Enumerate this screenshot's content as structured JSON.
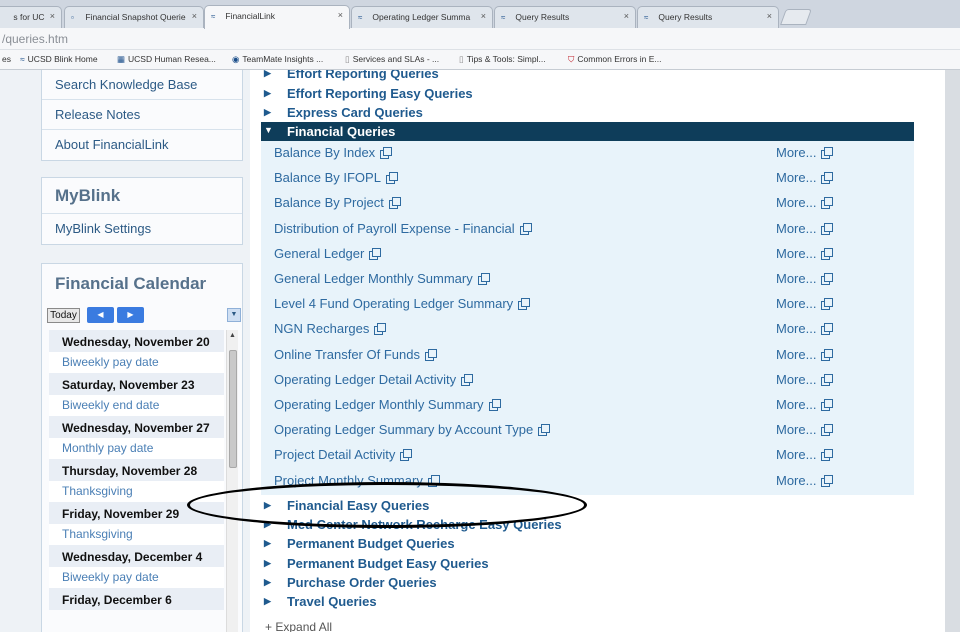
{
  "tabs": [
    {
      "label": "s for UC",
      "active": false
    },
    {
      "label": "Financial Snapshot Querie",
      "active": false
    },
    {
      "label": "FinancialLink",
      "active": true
    },
    {
      "label": "Operating Ledger Summa",
      "active": false
    },
    {
      "label": "Query Results",
      "active": false
    },
    {
      "label": "Query Results",
      "active": false
    }
  ],
  "tab_close_glyph": "×",
  "url": "/queries.htm",
  "bookmarks": [
    {
      "label": "es",
      "icon": ""
    },
    {
      "label": "UCSD Blink Home",
      "icon": "blink-icon"
    },
    {
      "label": "UCSD Human Resea...",
      "icon": "ucsd-icon"
    },
    {
      "label": "TeamMate Insights ...",
      "icon": "teammate-icon"
    },
    {
      "label": "Services and SLAs - ...",
      "icon": "doc-icon"
    },
    {
      "label": "Tips & Tools: Simpl...",
      "icon": "doc-icon"
    },
    {
      "label": "Common Errors in E...",
      "icon": "shield-icon"
    }
  ],
  "sidebar": {
    "help_links": [
      "Search Knowledge Base",
      "Release Notes",
      "About FinancialLink"
    ],
    "myblink": {
      "title": "MyBlink",
      "links": [
        "MyBlink Settings"
      ]
    },
    "calendar": {
      "title": "Financial Calendar",
      "today_label": "Today",
      "events": [
        {
          "date": "Wednesday, November 20",
          "items": [
            "Biweekly pay date"
          ]
        },
        {
          "date": "Saturday, November 23",
          "items": [
            "Biweekly end date"
          ]
        },
        {
          "date": "Wednesday, November 27",
          "items": [
            "Monthly pay date"
          ]
        },
        {
          "date": "Thursday, November 28",
          "items": [
            "Thanksgiving"
          ]
        },
        {
          "date": "Friday, November 29",
          "items": [
            "Thanksgiving"
          ]
        },
        {
          "date": "Wednesday, December 4",
          "items": [
            "Biweekly pay date"
          ]
        },
        {
          "date": "Friday, December 6",
          "items": []
        }
      ]
    }
  },
  "main": {
    "categories_above": [
      "Effort Reporting Queries",
      "Effort Reporting Easy Queries",
      "Express Card Queries"
    ],
    "expanded_category": "Financial Queries",
    "financial_queries": [
      "Balance By Index",
      "Balance By IFOPL",
      "Balance By Project",
      "Distribution of Payroll Expense - Financial",
      "General Ledger",
      "General Ledger Monthly Summary",
      "Level 4 Fund Operating Ledger Summary",
      "NGN Recharges",
      "Online Transfer Of Funds",
      "Operating Ledger Detail Activity",
      "Operating Ledger Monthly Summary",
      "Operating Ledger Summary by Account Type",
      "Project Detail Activity",
      "Project Monthly Summary"
    ],
    "more_label": "More...",
    "categories_below": [
      "Financial Easy Queries",
      "Med Center Network Recharge Easy Queries",
      "Permanent Budget Queries",
      "Permanent Budget Easy Queries",
      "Purchase Order Queries",
      "Travel Queries"
    ],
    "expand_all_label": "+ Expand All",
    "highlighted_query": "Operating Ledger Summary by Account Type"
  },
  "colors": {
    "link": "#2e6aa0",
    "category": "#1f5a8e",
    "header_bg": "#0e3d5a",
    "list_bg": "#e8f3fa"
  }
}
